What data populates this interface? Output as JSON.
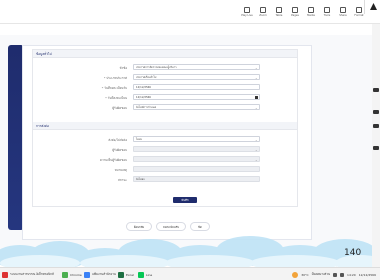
{
  "toolbar": {
    "items": [
      {
        "label": "Play Live",
        "icon": "play-icon"
      },
      {
        "label": "Zoom",
        "icon": "zoom-icon"
      },
      {
        "label": "Table",
        "icon": "table-icon"
      },
      {
        "label": "Pages",
        "icon": "pages-icon"
      },
      {
        "label": "Media",
        "icon": "media-icon"
      },
      {
        "label": "Tools",
        "icon": "tools-icon"
      },
      {
        "label": "Share",
        "icon": "share-icon"
      },
      {
        "label": "Format",
        "icon": "format-icon"
      }
    ]
  },
  "slide": {
    "page_number": "140",
    "section1": {
      "title": "ข้อมูลทั่วไป",
      "rows": [
        {
          "label": "หัวข้อ",
          "value": "ประกาศการจัดการสอบคณะผู้บริหาร",
          "control": "select"
        },
        {
          "label": "* ประเภทประกาศ",
          "value": "ประกาศเรื่องทั่วไป",
          "control": "select"
        },
        {
          "label": "* วันที่ลงทะเบียนรับ",
          "value": "12/12/2566",
          "control": "text"
        },
        {
          "label": "* วันที่ลงทะเบียน",
          "value": "12/12/2566",
          "control": "date"
        },
        {
          "label": "ผู้รับผิดชอบ",
          "value": "ยังไม่มีการกำหนด",
          "control": "select"
        }
      ]
    },
    "section2": {
      "title": "การส่งต่อ",
      "rows": [
        {
          "label": "ส่งต่อ/ไม่ส่งต่อ",
          "value": "ไม่ส่ง",
          "control": "select",
          "disabled": false
        },
        {
          "label": "ผู้รับผิดชอบ",
          "value": "",
          "control": "select",
          "disabled": true
        },
        {
          "label": "ความเห็นผู้รับผิดชอบ",
          "value": "",
          "control": "select",
          "disabled": true
        },
        {
          "label": "หมายเหตุ",
          "value": "",
          "control": "text",
          "disabled": true
        },
        {
          "label": "สถานะ",
          "value": "ยังไม่ส่ง",
          "control": "text",
          "disabled": true
        }
      ]
    },
    "save_label": "บันทึก",
    "bottom_buttons": [
      "ย้อนกลับ",
      "ลงทะเบียนรับ",
      "ปิด"
    ]
  },
  "taskbar": {
    "items": [
      {
        "label": "ระบบงานสารบรรณ อิเล็กทรอนิกส์",
        "color": "#d33"
      },
      {
        "label": "Chrome",
        "color": "#4caf50"
      },
      {
        "label": "แฟ้มงานสำนักงาน",
        "color": "#3b82f6"
      },
      {
        "label": "Excel",
        "color": "#1d6f42"
      },
      {
        "label": "Line",
        "color": "#06c755"
      }
    ],
    "weather": "30°C",
    "weather_desc": "มีแดดบางส่วน",
    "time": "14:20",
    "date": "12/12/2566"
  },
  "colors": {
    "brand_dark_blue": "#1f2c6d",
    "page_bg": "#ffffff",
    "card_border": "#e5e7ec"
  }
}
